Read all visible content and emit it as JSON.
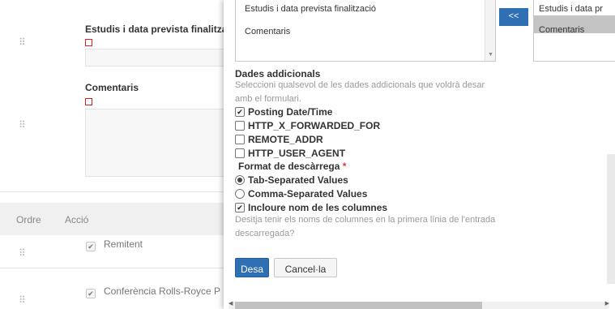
{
  "background": {
    "fields": [
      {
        "label": "Estudis i data prevista finalitzaci"
      },
      {
        "label": "Comentaris"
      }
    ],
    "table": {
      "headers": [
        "Ordre",
        "Acció"
      ],
      "rows": [
        {
          "checked": true,
          "label": "Remitent"
        },
        {
          "checked": true,
          "label": "Conferència Rolls-Royce P"
        }
      ]
    }
  },
  "modal": {
    "available_list": {
      "items": [
        "Estudis i data prevista finalització",
        "Comentaris"
      ]
    },
    "move_button_label": "<<",
    "selected_list": {
      "items": [
        "Estudis i data pr",
        "Comentaris"
      ],
      "highlighted": "Comentaris"
    },
    "additional_data": {
      "title": "Dades addicionals",
      "help": "Seleccioni qualsevol de les dades addicionals que voldrà desar amb el formulari.",
      "options": [
        {
          "label": "Posting Date/Time",
          "checked": true
        },
        {
          "label": "HTTP_X_FORWARDED_FOR",
          "checked": false
        },
        {
          "label": "REMOTE_ADDR",
          "checked": false
        },
        {
          "label": "HTTP_USER_AGENT",
          "checked": false
        }
      ]
    },
    "download_format": {
      "title": "Format de descàrrega",
      "required_mark": "*",
      "options": [
        {
          "label": "Tab-Separated Values",
          "selected": true
        },
        {
          "label": "Comma-Separated Values",
          "selected": false
        }
      ]
    },
    "include_columns": {
      "label": "Incloure nom de les columnes",
      "checked": true,
      "help": "Desitja tenir els noms de columnes en la primera línia de l'entrada descarregada?"
    },
    "buttons": {
      "save": "Desa",
      "cancel": "Cancel·la"
    }
  },
  "colors": {
    "primary": "#2f6fb4",
    "required": "#d8393c",
    "muted_text": "#9a9a9a"
  }
}
